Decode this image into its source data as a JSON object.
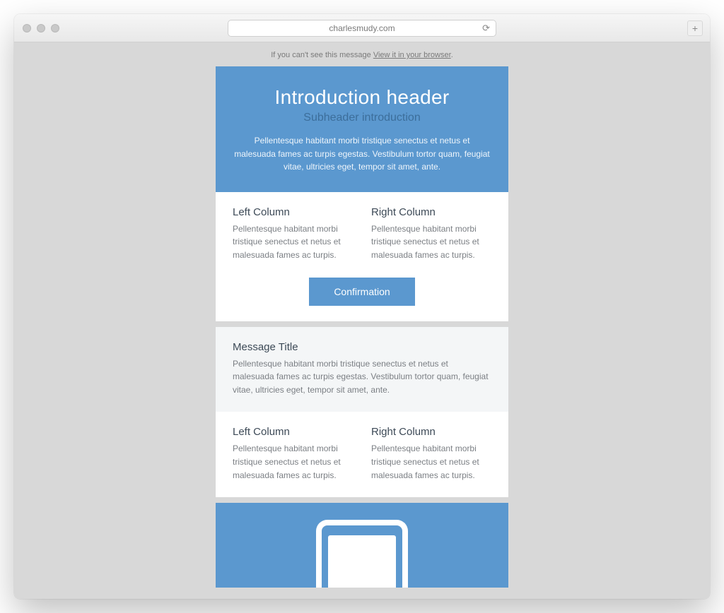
{
  "browser": {
    "url": "charlesmudy.com"
  },
  "preview": {
    "prefix": "If you can't see this message ",
    "link": "View it in your browser",
    "suffix": "."
  },
  "hero": {
    "title": "Introduction header",
    "subheader": "Subheader introduction",
    "body": "Pellentesque habitant morbi tristique senectus et netus et malesuada fames ac turpis egestas. Vestibulum tortor quam, feugiat vitae, ultricies eget, tempor sit amet, ante."
  },
  "columns1": {
    "left": {
      "title": "Left Column",
      "body": "Pellentesque habitant morbi tristique senectus et netus et malesuada fames ac turpis."
    },
    "right": {
      "title": "Right Column",
      "body": "Pellentesque habitant morbi tristique senectus et netus et malesuada fames ac turpis."
    }
  },
  "cta_label": "Confirmation",
  "message": {
    "title": "Message Title",
    "body": "Pellentesque habitant morbi tristique senectus et netus et malesuada fames ac turpis egestas. Vestibulum tortor quam, feugiat vitae, ultricies eget, tempor sit amet, ante."
  },
  "columns2": {
    "left": {
      "title": "Left Column",
      "body": "Pellentesque habitant morbi tristique senectus et netus et malesuada fames ac turpis."
    },
    "right": {
      "title": "Right Column",
      "body": "Pellentesque habitant morbi tristique senectus et netus et malesuada fames ac turpis."
    }
  }
}
